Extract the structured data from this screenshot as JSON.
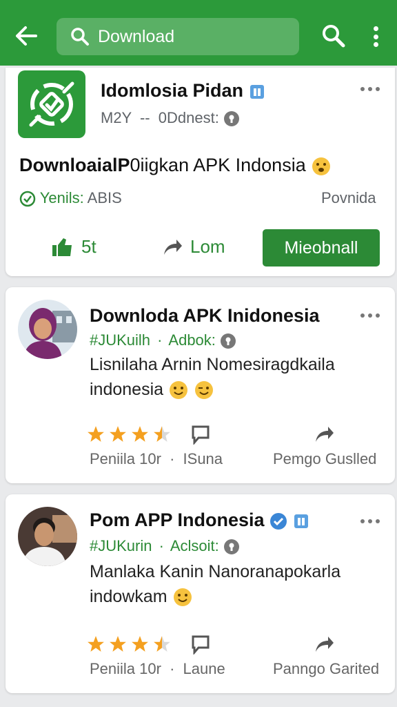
{
  "header": {
    "search_value": "Download"
  },
  "app_card": {
    "name": "Idomlosia Pidan",
    "meta_left": "M2Y",
    "meta_sep": "--",
    "meta_right": "0Ddnest:",
    "headline_bold": "DownloaialP",
    "headline_rest": "0iigkan APK Indonsia",
    "status_label": "Yenils:",
    "status_value": "ABIS",
    "status_right": "Povnida",
    "like_count": "5t",
    "share_label": "Lom",
    "primary_button": "Mieobnall"
  },
  "posts": [
    {
      "title": "Downloda APK Inidonesia",
      "handle": "#JUKuilh",
      "sep": "·",
      "handle_tag": "Adbok:",
      "body_line1": "Lisnilaha Arnin Nomesiragdkaila",
      "body_line2": "indonesia",
      "rating": 3.5,
      "meta_left": "Peniila 10r",
      "meta_sep": "·",
      "meta_mid": "ISuna",
      "meta_right": "Pemgo Guslled"
    },
    {
      "title": "Pom APP Indonesia",
      "handle": "#JUKurin",
      "sep": "·",
      "handle_tag": "Aclsoit:",
      "body_line1": "Manlaka Kanin Nanoranapokarla",
      "body_line2": "indowkam",
      "rating": 3.5,
      "meta_left": "Peniila 10r",
      "meta_sep": "·",
      "meta_mid": "Laune",
      "meta_right": "Panngo Garited"
    }
  ],
  "colors": {
    "brand_green": "#2c9a3a",
    "accent_green": "#2c8a36",
    "star": "#f4a020"
  }
}
